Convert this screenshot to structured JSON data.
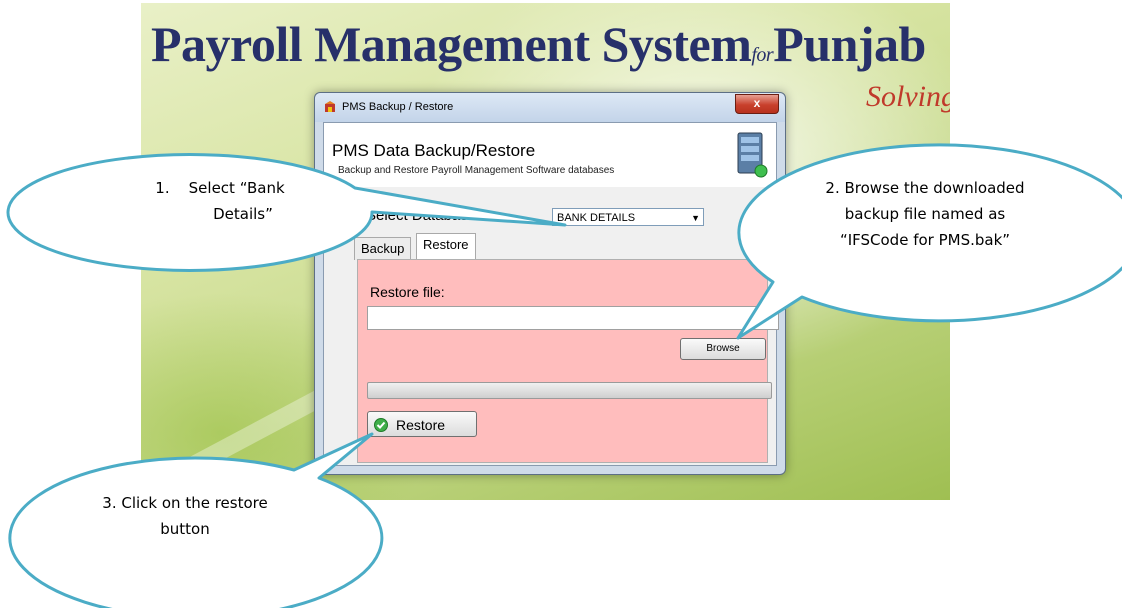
{
  "background": {
    "title_main": "Payroll Management System",
    "title_for": "for",
    "title_place": "Punjab",
    "tagline": "Solving"
  },
  "window": {
    "title": "PMS Backup / Restore",
    "close_label": "x",
    "header_title": "PMS Data Backup/Restore",
    "header_subtitle": "Backup and Restore Payroll Management Software databases",
    "select_label": "Select Database",
    "select_colon": ":",
    "select_value": "BANK DETAILS",
    "tabs": [
      "Backup",
      "Restore"
    ],
    "restore_file_label": "Restore file:",
    "restore_file_value": "",
    "browse_label": "Browse",
    "progress_fraction": 0,
    "restore_button_label": "Restore"
  },
  "callouts": {
    "step1_line1": "1.    Select “Bank",
    "step1_line2": "Details”",
    "step2_line1": "2. Browse the downloaded",
    "step2_line2": "backup file named as",
    "step2_line3": "“IFSCode for PMS.bak”",
    "step3_line1": "3. Click on the restore",
    "step3_line2": "button"
  },
  "colors": {
    "callout_border": "#4bacc6",
    "panel_bg": "#ffbdbd",
    "title_blue": "#27306a",
    "tagline_red": "#c0392b"
  }
}
